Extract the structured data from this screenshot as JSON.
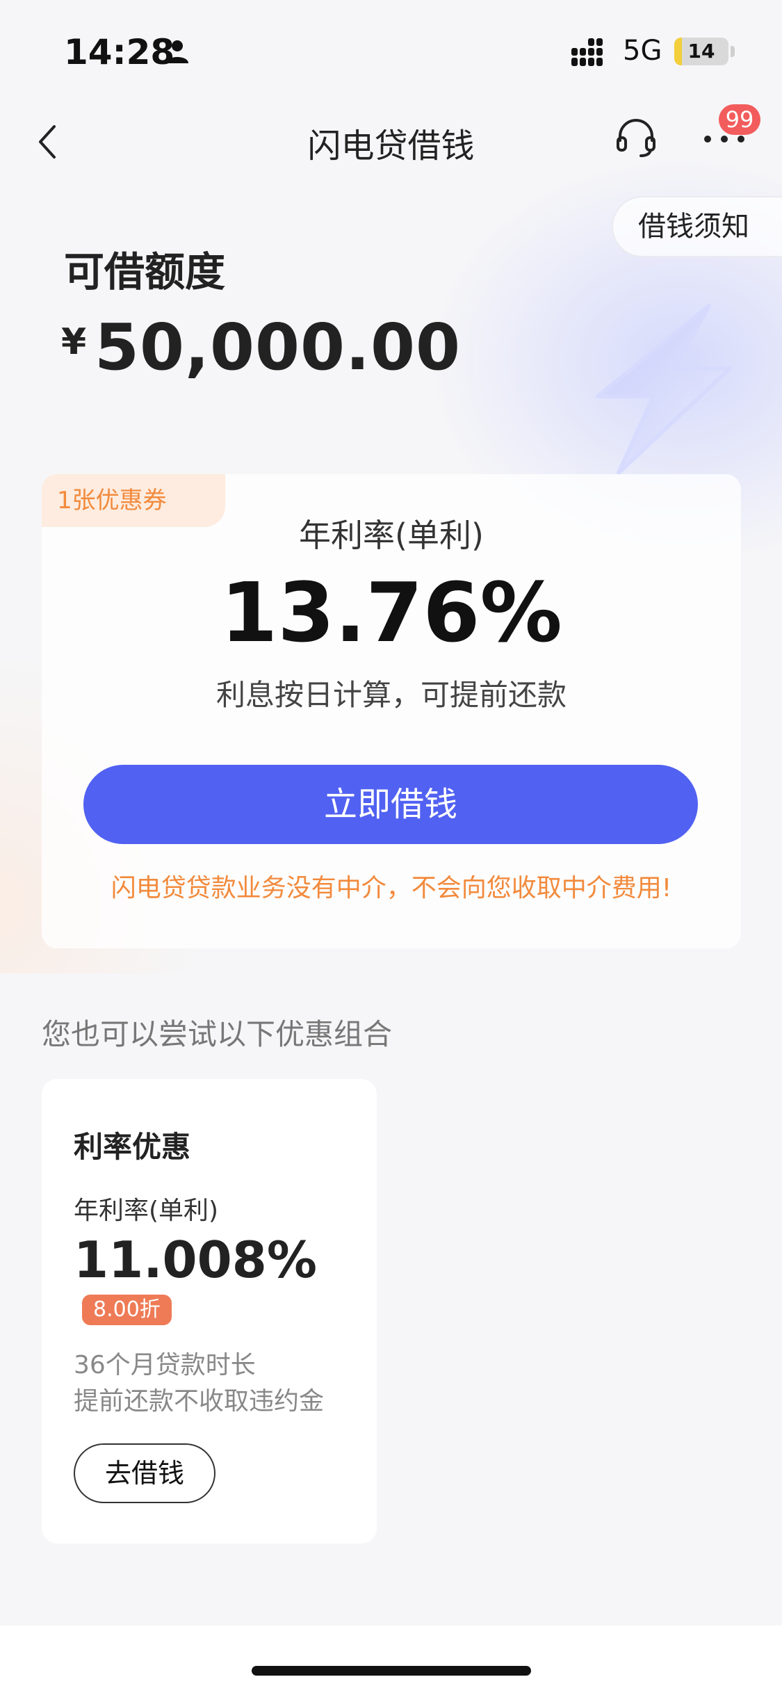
{
  "status_bar": {
    "time": "14:28",
    "network": "5G",
    "battery": "14",
    "battery_level": 0.14
  },
  "nav": {
    "title": "闪电贷借钱",
    "badge": "99"
  },
  "notice_button": "借钱须知",
  "credit": {
    "label": "可借额度",
    "currency": "¥",
    "amount": "50,000.00"
  },
  "main_card": {
    "coupon_tag": "1张优惠券",
    "rate_label": "年利率(单利)",
    "rate_value": "13.76%",
    "rate_note": "利息按日计算，可提前还款",
    "borrow_button": "立即借钱",
    "warning": "闪电贷贷款业务没有中介，不会向您收取中介费用!"
  },
  "section_title": "您也可以尝试以下优惠组合",
  "offer": {
    "title": "利率优惠",
    "rate_label": "年利率(单利)",
    "rate_value": "11.008%",
    "discount": "8.00折",
    "term": "36个月贷款时长",
    "fee": "提前还款不收取违约金",
    "button": "去借钱"
  },
  "colors": {
    "accent": "#5161f2",
    "warning": "#f28a3c",
    "badge": "#f25c5c",
    "discount": "#ee7b56"
  },
  "icons": [
    "person-icon",
    "signal-icon",
    "back-icon",
    "headset-icon",
    "more-icon",
    "bolt-icon"
  ]
}
